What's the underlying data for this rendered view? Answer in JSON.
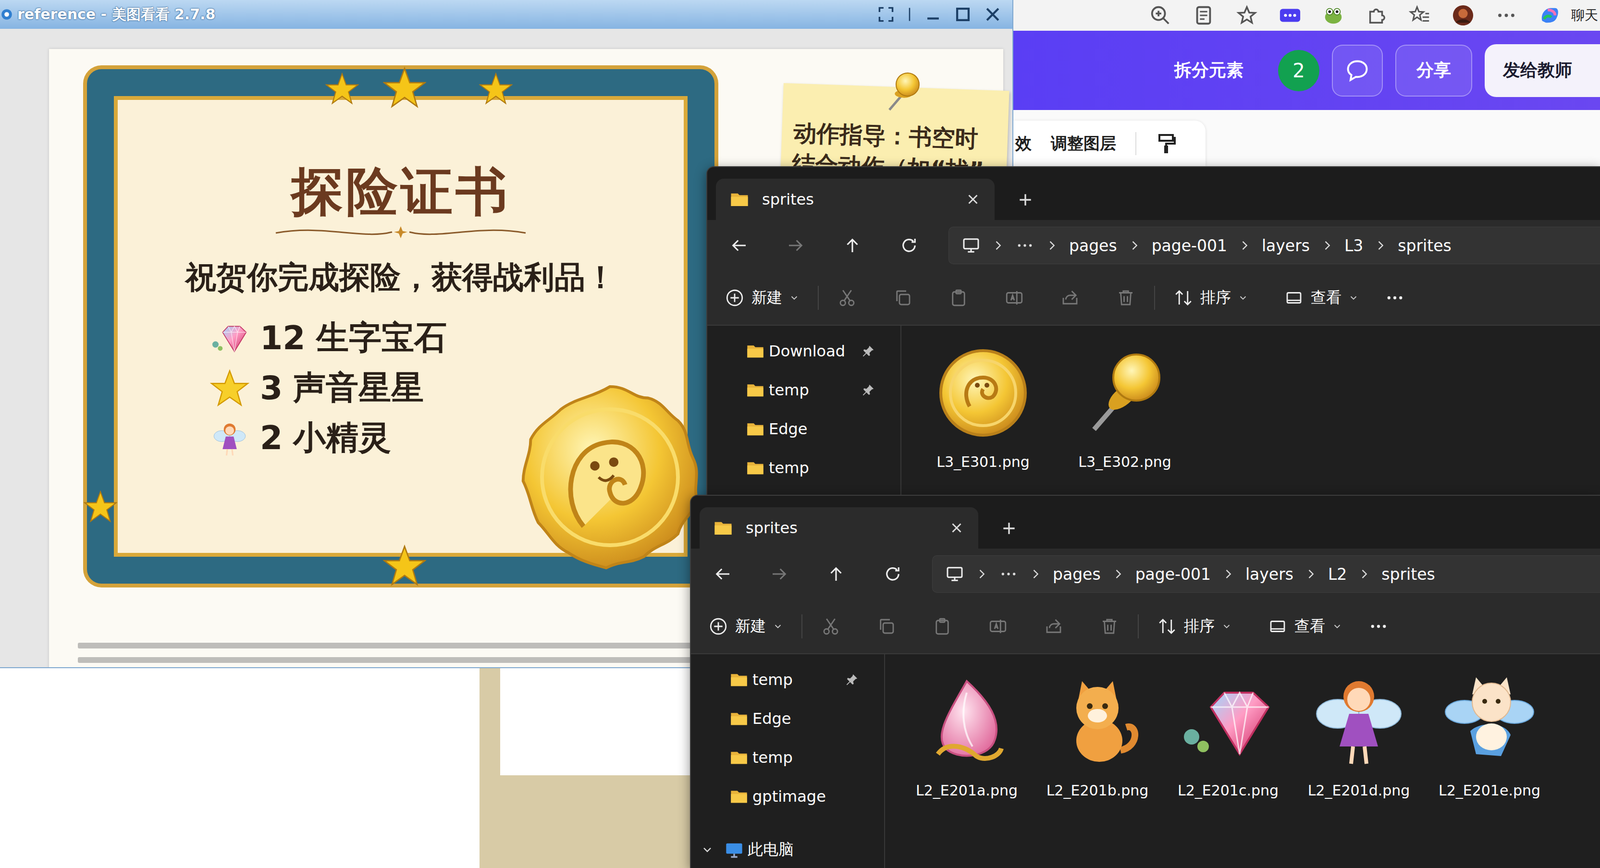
{
  "viewer": {
    "title": "reference - 美图看看 2.7.8",
    "certificate": {
      "title": "探险证书",
      "subtitle": "祝贺你完成探险，获得战利品！",
      "rewards": [
        {
          "count": "12",
          "label": "生字宝石",
          "kind": "gem"
        },
        {
          "count": "3",
          "label": "声音星星",
          "kind": "star"
        },
        {
          "count": "2",
          "label": "小精灵",
          "kind": "fairy"
        }
      ],
      "note": [
        "动作指导：书空时",
        "结合动作（如“找”"
      ]
    }
  },
  "browser": {
    "profile_label": "聊天",
    "split_label": "拆分元素",
    "badge": "2",
    "share": "分享",
    "send": "发给教师",
    "tools": [
      "效",
      "调整图层"
    ]
  },
  "explorers": [
    {
      "tab": "sprites",
      "breadcrumb": [
        "pages",
        "page-001",
        "layers",
        "L3",
        "sprites"
      ],
      "toolbar": {
        "new": "新建",
        "sort": "排序",
        "view": "查看"
      },
      "sidebar": [
        {
          "label": "Download",
          "pinned": true
        },
        {
          "label": "temp",
          "pinned": true
        },
        {
          "label": "Edge",
          "pinned": false
        },
        {
          "label": "temp",
          "pinned": false
        }
      ],
      "files": [
        {
          "name": "L3_E301.png",
          "kind": "coin"
        },
        {
          "name": "L3_E302.png",
          "kind": "pin"
        }
      ]
    },
    {
      "tab": "sprites",
      "breadcrumb": [
        "pages",
        "page-001",
        "layers",
        "L2",
        "sprites"
      ],
      "toolbar": {
        "new": "新建",
        "sort": "排序",
        "view": "查看"
      },
      "sidebar": [
        {
          "label": "temp",
          "pinned": true
        },
        {
          "label": "Edge",
          "pinned": false
        },
        {
          "label": "temp",
          "pinned": false
        },
        {
          "label": "gptimage",
          "pinned": false
        }
      ],
      "this_pc": {
        "label": "此电脑",
        "expanded": true
      },
      "files": [
        {
          "name": "L2_E201a.png",
          "kind": "shell"
        },
        {
          "name": "L2_E201b.png",
          "kind": "cat"
        },
        {
          "name": "L2_E201c.png",
          "kind": "gem"
        },
        {
          "name": "L2_E201d.png",
          "kind": "fairy"
        },
        {
          "name": "L2_E201e.png",
          "kind": "flycat"
        }
      ]
    }
  ]
}
